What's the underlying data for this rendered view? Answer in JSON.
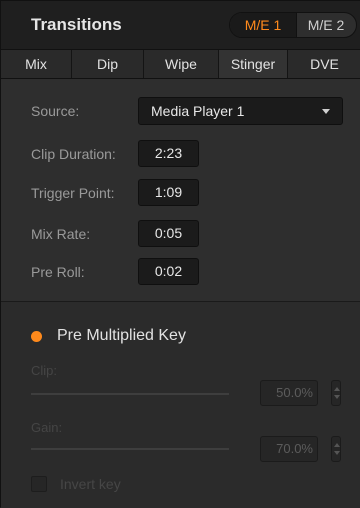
{
  "header": {
    "title": "Transitions",
    "me_buttons": [
      {
        "label": "M/E 1",
        "active": true
      },
      {
        "label": "M/E 2",
        "active": false
      }
    ]
  },
  "tabs": [
    {
      "label": "Mix",
      "active": false
    },
    {
      "label": "Dip",
      "active": false
    },
    {
      "label": "Wipe",
      "active": false
    },
    {
      "label": "Stinger",
      "active": true
    },
    {
      "label": "DVE",
      "active": false
    }
  ],
  "stinger": {
    "source_label": "Source:",
    "source_value": "Media Player 1",
    "clip_duration_label": "Clip Duration:",
    "clip_duration_value": "2:23",
    "trigger_point_label": "Trigger Point:",
    "trigger_point_value": "1:09",
    "mix_rate_label": "Mix Rate:",
    "mix_rate_value": "0:05",
    "pre_roll_label": "Pre Roll:",
    "pre_roll_value": "0:02"
  },
  "key": {
    "pre_multiplied_label": "Pre Multiplied Key",
    "pre_multiplied_selected": true,
    "clip_label": "Clip:",
    "clip_value": "50.0%",
    "gain_label": "Gain:",
    "gain_value": "70.0%",
    "invert_label": "Invert key",
    "invert_checked": false
  },
  "colors": {
    "accent": "#ff8a1c",
    "background": "#2e2e2e",
    "field": "#1b1b1b"
  }
}
